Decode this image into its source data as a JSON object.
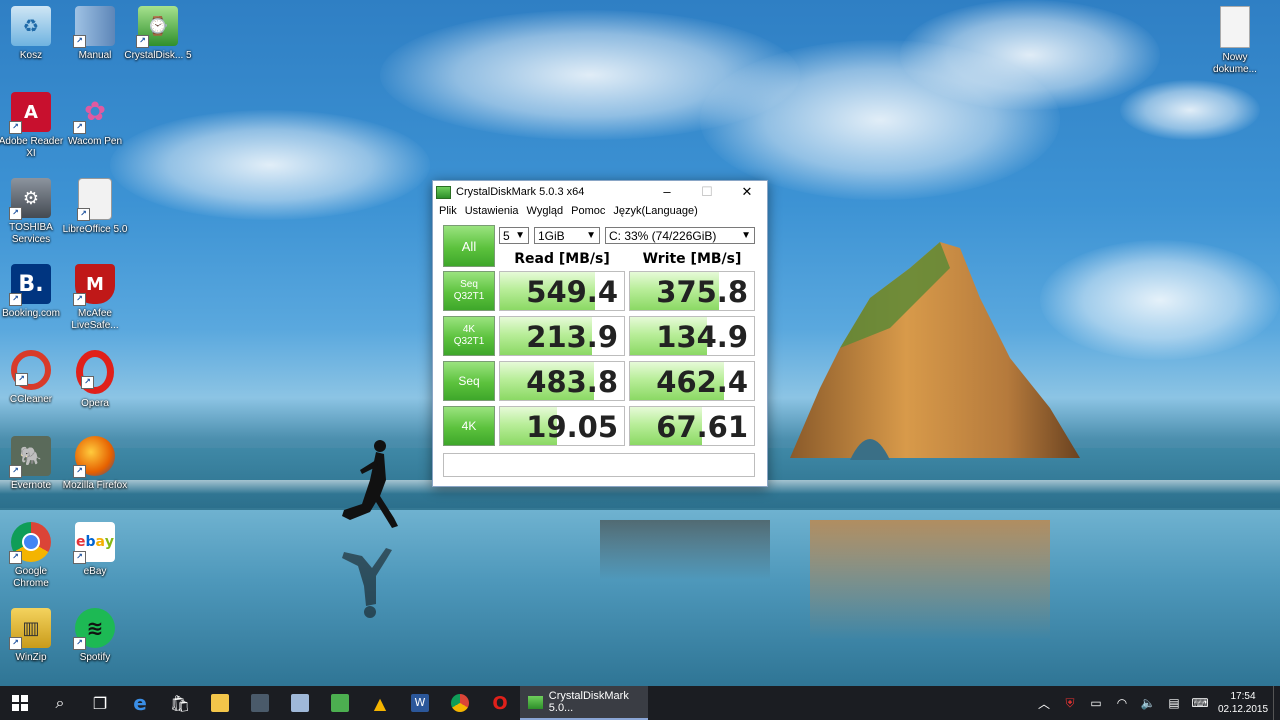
{
  "desktop_icons": [
    {
      "label": "Kosz",
      "icon": "recycle-bin-icon",
      "color": "#6fb3e0"
    },
    {
      "label": "Manual",
      "icon": "folder-icon",
      "color": "#7fa3c8"
    },
    {
      "label": "CrystalDisk... 5",
      "icon": "crystaldiskmark-icon",
      "color": "#4caf50"
    },
    {
      "label": "Adobe Reader XI",
      "icon": "adobe-reader-icon",
      "color": "#c8102e"
    },
    {
      "label": "Wacom Pen",
      "icon": "wacom-pen-icon",
      "color": "#e0e0e0"
    },
    {
      "label": "TOSHIBA Services",
      "icon": "toshiba-services-icon",
      "color": "#555c66"
    },
    {
      "label": "LibreOffice 5.0",
      "icon": "libreoffice-icon",
      "color": "#f2f2f2"
    },
    {
      "label": "Booking.com",
      "icon": "booking-icon",
      "color": "#003580"
    },
    {
      "label": "McAfee LiveSafe...",
      "icon": "mcafee-icon",
      "color": "#c01818"
    },
    {
      "label": "CCleaner",
      "icon": "ccleaner-icon",
      "color": "#d83b2a"
    },
    {
      "label": "Opera",
      "icon": "opera-icon",
      "color": "#e0201a"
    },
    {
      "label": "Evernote",
      "icon": "evernote-icon",
      "color": "#5a6a5a"
    },
    {
      "label": "Mozilla Firefox",
      "icon": "firefox-icon",
      "color": "#e66000"
    },
    {
      "label": "Google Chrome",
      "icon": "chrome-icon",
      "color": "#2e9d4c"
    },
    {
      "label": "eBay",
      "icon": "ebay-icon",
      "color": "#ffffff"
    },
    {
      "label": "WinZip",
      "icon": "winzip-icon",
      "color": "#e8c23a"
    },
    {
      "label": "Spotify",
      "icon": "spotify-icon",
      "color": "#1db954"
    },
    {
      "label": "Nowy dokume...",
      "icon": "new-document-icon",
      "color": "#f4f4f4"
    }
  ],
  "window": {
    "title": "CrystalDiskMark 5.0.3 x64",
    "menu": [
      "Plik",
      "Ustawienia",
      "Wygląd",
      "Pomoc",
      "Język(Language)"
    ],
    "all_button": "All",
    "count_select": "5",
    "size_select": "1GiB",
    "drive_select": "C: 33% (74/226GiB)",
    "read_header": "Read [MB/s]",
    "write_header": "Write [MB/s]",
    "rows": [
      {
        "label_line1": "Seq",
        "label_line2": "Q32T1",
        "read": "549.4",
        "write": "375.8",
        "read_fill": 0.77,
        "write_fill": 0.72
      },
      {
        "label_line1": "4K",
        "label_line2": "Q32T1",
        "read": "213.9",
        "write": "134.9",
        "read_fill": 0.74,
        "write_fill": 0.62
      },
      {
        "label_line1": "Seq",
        "label_line2": "",
        "read": "483.8",
        "write": "462.4",
        "read_fill": 0.76,
        "write_fill": 0.76
      },
      {
        "label_line1": "4K",
        "label_line2": "",
        "read": "19.05",
        "write": "67.61",
        "read_fill": 0.46,
        "write_fill": 0.58
      }
    ]
  },
  "taskbar": {
    "active_app": "CrystalDiskMark 5.0...",
    "time": "17:54",
    "date": "02.12.2015"
  },
  "colors": {
    "taskbar": "#1b1d22",
    "green_button": "#5cc23d",
    "bar_fill": "#b9ee9a"
  }
}
